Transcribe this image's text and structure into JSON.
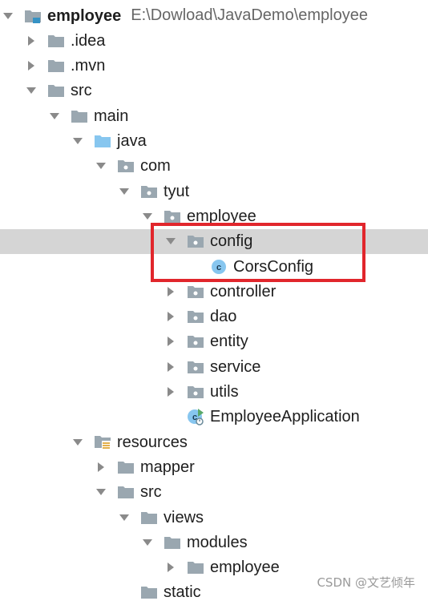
{
  "tree": [
    {
      "label": "employee",
      "path": "E:\\Dowload\\JavaDemo\\employee",
      "bold": true,
      "icon": "module-folder-icon",
      "expanded": true,
      "depth": 0
    },
    {
      "label": ".idea",
      "icon": "folder-icon",
      "expanded": false,
      "depth": 1
    },
    {
      "label": ".mvn",
      "icon": "folder-icon",
      "expanded": false,
      "depth": 1
    },
    {
      "label": "src",
      "icon": "folder-icon",
      "expanded": true,
      "depth": 1
    },
    {
      "label": "main",
      "icon": "folder-icon",
      "expanded": true,
      "depth": 2
    },
    {
      "label": "java",
      "icon": "source-root-folder-icon",
      "expanded": true,
      "depth": 3
    },
    {
      "label": "com",
      "icon": "package-icon",
      "expanded": true,
      "depth": 4
    },
    {
      "label": "tyut",
      "icon": "package-icon",
      "expanded": true,
      "depth": 5
    },
    {
      "label": "employee",
      "icon": "package-icon",
      "expanded": true,
      "depth": 6
    },
    {
      "label": "config",
      "icon": "package-icon",
      "expanded": true,
      "depth": 7,
      "selected": true
    },
    {
      "label": "CorsConfig",
      "icon": "class-icon",
      "leaf": true,
      "depth": 8
    },
    {
      "label": "controller",
      "icon": "package-icon",
      "expanded": false,
      "depth": 7
    },
    {
      "label": "dao",
      "icon": "package-icon",
      "expanded": false,
      "depth": 7
    },
    {
      "label": "entity",
      "icon": "package-icon",
      "expanded": false,
      "depth": 7
    },
    {
      "label": "service",
      "icon": "package-icon",
      "expanded": false,
      "depth": 7
    },
    {
      "label": "utils",
      "icon": "package-icon",
      "expanded": false,
      "depth": 7
    },
    {
      "label": "EmployeeApplication",
      "icon": "spring-boot-class-icon",
      "leaf": true,
      "depth": 7
    },
    {
      "label": "resources",
      "icon": "resources-folder-icon",
      "expanded": true,
      "depth": 3
    },
    {
      "label": "mapper",
      "icon": "folder-icon",
      "expanded": false,
      "depth": 4
    },
    {
      "label": "src",
      "icon": "folder-icon",
      "expanded": true,
      "depth": 4
    },
    {
      "label": "views",
      "icon": "folder-icon",
      "expanded": true,
      "depth": 5
    },
    {
      "label": "modules",
      "icon": "folder-icon",
      "expanded": true,
      "depth": 6
    },
    {
      "label": "employee",
      "icon": "folder-icon",
      "expanded": false,
      "depth": 7
    },
    {
      "label": "static",
      "icon": "folder-icon",
      "expanded": false,
      "leaf": true,
      "depth": 5
    }
  ],
  "watermark": "CSDN @文艺倾年",
  "colors": {
    "folder": "#9aa7b0",
    "source_root": "#87c6ef",
    "class_circle": "#87c6ef",
    "selection": "#d5d5d5",
    "highlight": "#e1262c"
  }
}
